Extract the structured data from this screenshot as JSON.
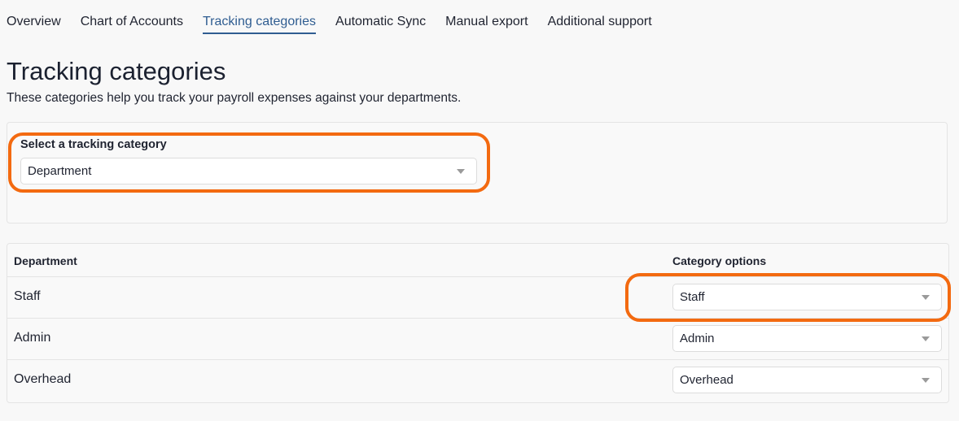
{
  "tabs": [
    {
      "label": "Overview"
    },
    {
      "label": "Chart of Accounts"
    },
    {
      "label": "Tracking categories",
      "active": true
    },
    {
      "label": "Automatic Sync"
    },
    {
      "label": "Manual export"
    },
    {
      "label": "Additional support"
    }
  ],
  "page": {
    "title": "Tracking categories",
    "subtitle": "These categories help you track your payroll expenses against your departments."
  },
  "tracking_select": {
    "label": "Select a tracking category",
    "value": "Department"
  },
  "table": {
    "headers": [
      "Department",
      "Category options"
    ],
    "rows": [
      {
        "name": "Staff",
        "option": "Staff"
      },
      {
        "name": "Admin",
        "option": "Admin"
      },
      {
        "name": "Overhead",
        "option": "Overhead"
      }
    ]
  },
  "colors": {
    "accent": "#2f5d91",
    "highlight": "#f36a10",
    "background": "#f8f8f8"
  }
}
